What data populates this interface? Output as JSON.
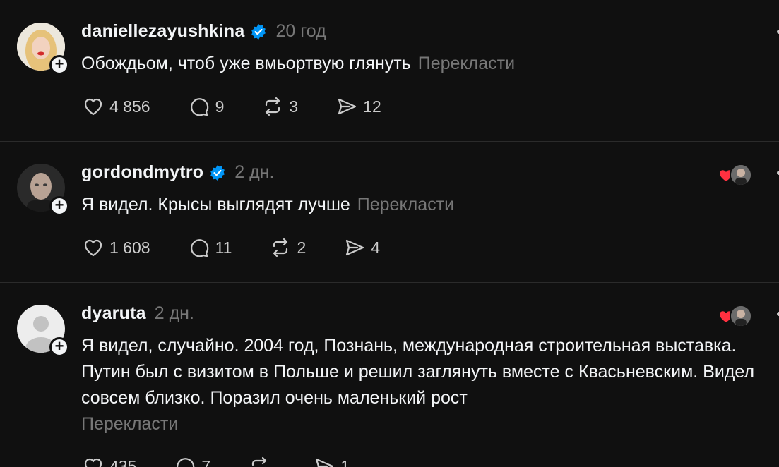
{
  "posts": [
    {
      "username": "daniellezayushkina",
      "verified": true,
      "time": "20 год",
      "text": "Обождьом, чтоб уже вмьортвую глянуть",
      "translate": "Перекласти",
      "likes": "4 856",
      "replies": "9",
      "reposts": "3",
      "shares": "12",
      "avatar_icon": "avatar-photo-blonde"
    },
    {
      "username": "gordondmytro",
      "verified": true,
      "time": "2 дн.",
      "text": "Я видел. Крысы выглядят лучше",
      "translate": "Перекласти",
      "likes": "1 608",
      "replies": "11",
      "reposts": "2",
      "shares": "4",
      "avatar_icon": "avatar-photo-man"
    },
    {
      "username": "dyaruta",
      "verified": false,
      "time": "2 дн.",
      "text": "Я видел, случайно. 2004 год, Познань, международная строительная выставка. Путин был с визитом в Польше и решил заглянуть вместе с Квасьневским. Видел совсем близко. Поразил очень маленький рост",
      "translate": "Перекласти",
      "likes": "435",
      "replies": "7",
      "reposts": "",
      "shares": "1",
      "avatar_icon": "default-avatar-icon"
    }
  ],
  "colors": {
    "background": "#101010",
    "text": "#f3f5f7",
    "muted": "#777777",
    "verified": "#0095f6",
    "heart": "#ff3040"
  }
}
